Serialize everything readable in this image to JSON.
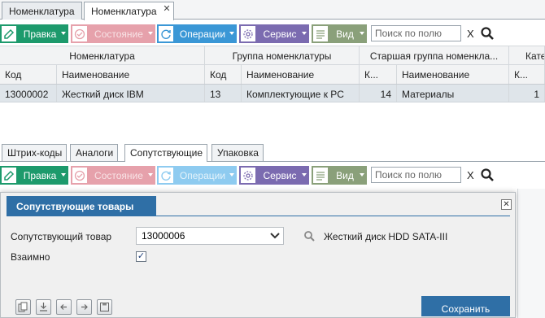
{
  "top_tabs": [
    {
      "label": "Номенклатура"
    },
    {
      "label": "Номенклатура",
      "close": "✕"
    }
  ],
  "toolbar1": {
    "edit": "Правка",
    "state": "Состояние",
    "operations": "Операции",
    "service": "Сервис",
    "view": "Вид",
    "search_placeholder": "Поиск по полю",
    "clear": "X"
  },
  "grid": {
    "group_headers": [
      "Номенклатура",
      "Группа номенклатуры",
      "Старшая группа номенкла...",
      "Кате"
    ],
    "columns": [
      "Код",
      "Наименование",
      "Код",
      "Наименование",
      "К...",
      "Наименование",
      "К..."
    ],
    "rows": [
      [
        "13000002",
        "Жесткий диск IBM",
        "13",
        "Комплектующие к PC",
        "14",
        "Материалы",
        "1"
      ]
    ]
  },
  "sub_tabs": [
    "Штрих-коды",
    "Аналоги",
    "Сопутствующие",
    "Упаковка"
  ],
  "toolbar2": {
    "edit": "Правка",
    "state": "Состояние",
    "operations": "Операции",
    "service": "Сервис",
    "view": "Вид",
    "search_placeholder": "Поиск по полю",
    "clear": "X"
  },
  "dialog": {
    "title": "Сопутствующие товары",
    "close": "✕",
    "related_label": "Сопутствующий товар",
    "related_value": "13000006",
    "related_name": "Жесткий диск HDD SATA-III",
    "mutual_label": "Взаимно",
    "mutual_checked": "✓",
    "save": "Сохранить"
  },
  "colors": {
    "green": "#1d9a6c",
    "blue": "#3a97d6",
    "purple": "#7b6bb0",
    "olive": "#8aa07a",
    "pink_disabled": "#e6a1ab",
    "dialog_title": "#2f6fa6"
  }
}
